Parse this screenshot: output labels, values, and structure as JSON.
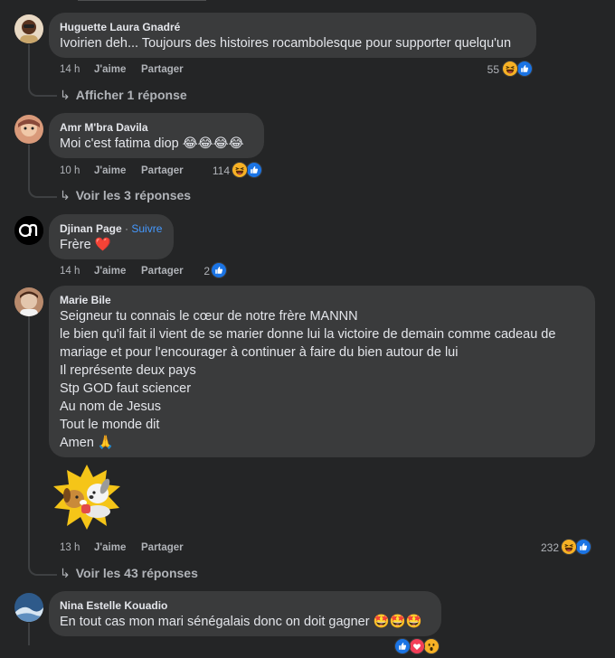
{
  "actions": {
    "like": "J'aime",
    "share": "Partager"
  },
  "colors": {
    "background": "#242526",
    "bubble": "#3a3b3c",
    "meta": "#b0b3b8",
    "follow": "#4599ff",
    "like": "#1b74e4",
    "haha": "#f7b125"
  },
  "comments": [
    {
      "author": "Huguette Laura Gnadré",
      "lines": [
        "Ivoirien deh... Toujours des histoires rocambolesque pour supporter quelqu'un"
      ],
      "time": "14 h",
      "reaction_count": "55",
      "reactions": [
        "haha-icon",
        "like-icon"
      ],
      "replies": "Afficher 1 réponse"
    },
    {
      "author": "Amr M'bra Davila",
      "lines": [
        "Moi c'est fatima diop 😂😂😂😂"
      ],
      "time": "10 h",
      "reaction_count": "114",
      "reactions": [
        "haha-icon",
        "like-icon"
      ],
      "replies": "Voir les 3 réponses"
    },
    {
      "author": "Djinan Page",
      "follow": "Suivre",
      "separator": "·",
      "lines": [
        "Frère ❤️"
      ],
      "time": "14 h",
      "reaction_count": "2",
      "reactions": [
        "like-icon"
      ]
    },
    {
      "author": "Marie Bile",
      "lines": [
        "Seigneur tu connais le cœur de notre frère MANNN",
        "le bien qu'il fait il vient de se marier donne lui la victoire de demain comme cadeau de",
        "mariage et pour l'encourager à continuer à faire du bien autour de lui",
        "Il représente deux pays",
        "Stp GOD faut sciencer",
        "Au nom de Jesus",
        "Tout le monde dit",
        "Amen 🙏"
      ],
      "sticker": "dog-sticker",
      "time": "13 h",
      "reaction_count": "232",
      "reactions": [
        "haha-icon",
        "like-icon"
      ],
      "replies": "Voir les 43 réponses"
    },
    {
      "author": "Nina Estelle Kouadio",
      "lines": [
        "En tout cas mon mari sénégalais donc on doit gagner 🤩🤩🤩"
      ],
      "reactions": [
        "like-icon",
        "love-icon",
        "wow-icon"
      ]
    }
  ]
}
